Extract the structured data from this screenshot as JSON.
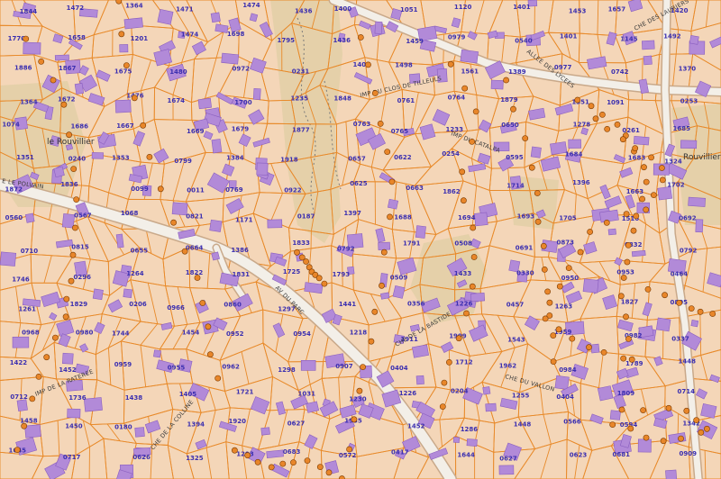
{
  "colors": {
    "land": "#f4d6b8",
    "parcel_line": "#e88a2a",
    "building": "#b28ad8",
    "building_edge": "#8a5fbf",
    "road": "#f3efe8",
    "road_edge": "#c9a98a",
    "green": "#d9c9a0",
    "poi": "#e8862a",
    "poi_edge": "#7a3a00",
    "plot_text": "#3b2fb0"
  },
  "place_labels": [
    {
      "id": "rouvillier",
      "text": "le Rouvillier"
    },
    {
      "id": "rouvilliera",
      "text": "Rouvillier"
    }
  ],
  "street_labels": [
    {
      "id": "polvain",
      "text": "E LE POLVAIN"
    },
    {
      "id": "clos-tilleuls",
      "text": "IMP DU CLOS DE TILLEULS"
    },
    {
      "id": "lauriers",
      "text": "CHE DES LAURIERS"
    },
    {
      "id": "lycees",
      "text": "ALLEE DES LYCEES"
    },
    {
      "id": "catalpa",
      "text": "IMP DU CATALPA"
    },
    {
      "id": "chemin-rural",
      "text": "CHE DE LA BASTIDE"
    },
    {
      "id": "parc",
      "text": "AV DU PARC"
    },
    {
      "id": "alles",
      "text": "IMP DE LA RATEREE"
    },
    {
      "id": "quaggin",
      "text": "CHE DE LA COLLINE"
    },
    {
      "id": "vallon",
      "text": "CHE DU VALLON"
    }
  ],
  "parcels": [
    "1844",
    "1472",
    "1364",
    "1471",
    "1474",
    "1436",
    "1400",
    "1051",
    "1120",
    "1401",
    "1453",
    "1657",
    "1420",
    "1770",
    "1658",
    "1201",
    "1474",
    "1698",
    "1795",
    "1436",
    "1459",
    "0979",
    "0540",
    "1401",
    "1145",
    "1492",
    "1886",
    "1867",
    "1675",
    "1480",
    "0972",
    "0231",
    "1406",
    "1498",
    "1561",
    "1389",
    "0977",
    "0742",
    "1370",
    "1364",
    "1672",
    "1476",
    "1674",
    "1700",
    "1235",
    "1848",
    "0761",
    "0764",
    "1879",
    "1351",
    "1091",
    "0253",
    "1074",
    "1686",
    "1667",
    "1669",
    "1679",
    "1877",
    "0763",
    "0765",
    "1233",
    "0650",
    "1278",
    "0261",
    "1685",
    "1351",
    "0240",
    "1353",
    "0799",
    "1384",
    "1918",
    "0657",
    "0622",
    "0254",
    "0595",
    "1684",
    "1683",
    "1324",
    "1872",
    "1836",
    "0099",
    "0011",
    "0769",
    "0922",
    "0625",
    "0663",
    "1862",
    "1714",
    "1396",
    "1663",
    "1702",
    "0560",
    "0567",
    "1068",
    "0821",
    "1171",
    "0187",
    "1397",
    "1688",
    "1694",
    "1693",
    "1705",
    "1516",
    "0692",
    "0710",
    "0815",
    "0655",
    "0664",
    "1386",
    "1833",
    "0792",
    "1791",
    "0508",
    "0691",
    "0873",
    "0832",
    "0792",
    "1746",
    "0296",
    "1264",
    "1822",
    "1831",
    "1725",
    "1793",
    "0509",
    "1433",
    "0330",
    "0950",
    "0953",
    "0464",
    "1261",
    "1829",
    "0206",
    "0966",
    "0860",
    "1297",
    "1441",
    "0356",
    "1226",
    "0457",
    "1263",
    "1827",
    "0805",
    "0968",
    "0980",
    "1744",
    "1454",
    "0952",
    "0954",
    "1218",
    "1911",
    "1909",
    "1543",
    "1959",
    "0982",
    "0337",
    "1422",
    "1452",
    "0959",
    "0955",
    "0962",
    "1298",
    "0907",
    "0404",
    "1712",
    "1962",
    "0984",
    "1789",
    "1448",
    "0712",
    "1736",
    "1438",
    "1405",
    "1721",
    "1031",
    "1230",
    "1226",
    "0204",
    "1255",
    "0404",
    "1809",
    "0714",
    "1458",
    "1450",
    "0180",
    "1394",
    "1920",
    "0627",
    "1935",
    "1452",
    "1286",
    "1448",
    "0566",
    "0594",
    "1342",
    "1645",
    "0717",
    "0626",
    "1325",
    "1293",
    "0683",
    "0572",
    "0417",
    "1644",
    "0627",
    "0623",
    "0681",
    "0909"
  ]
}
